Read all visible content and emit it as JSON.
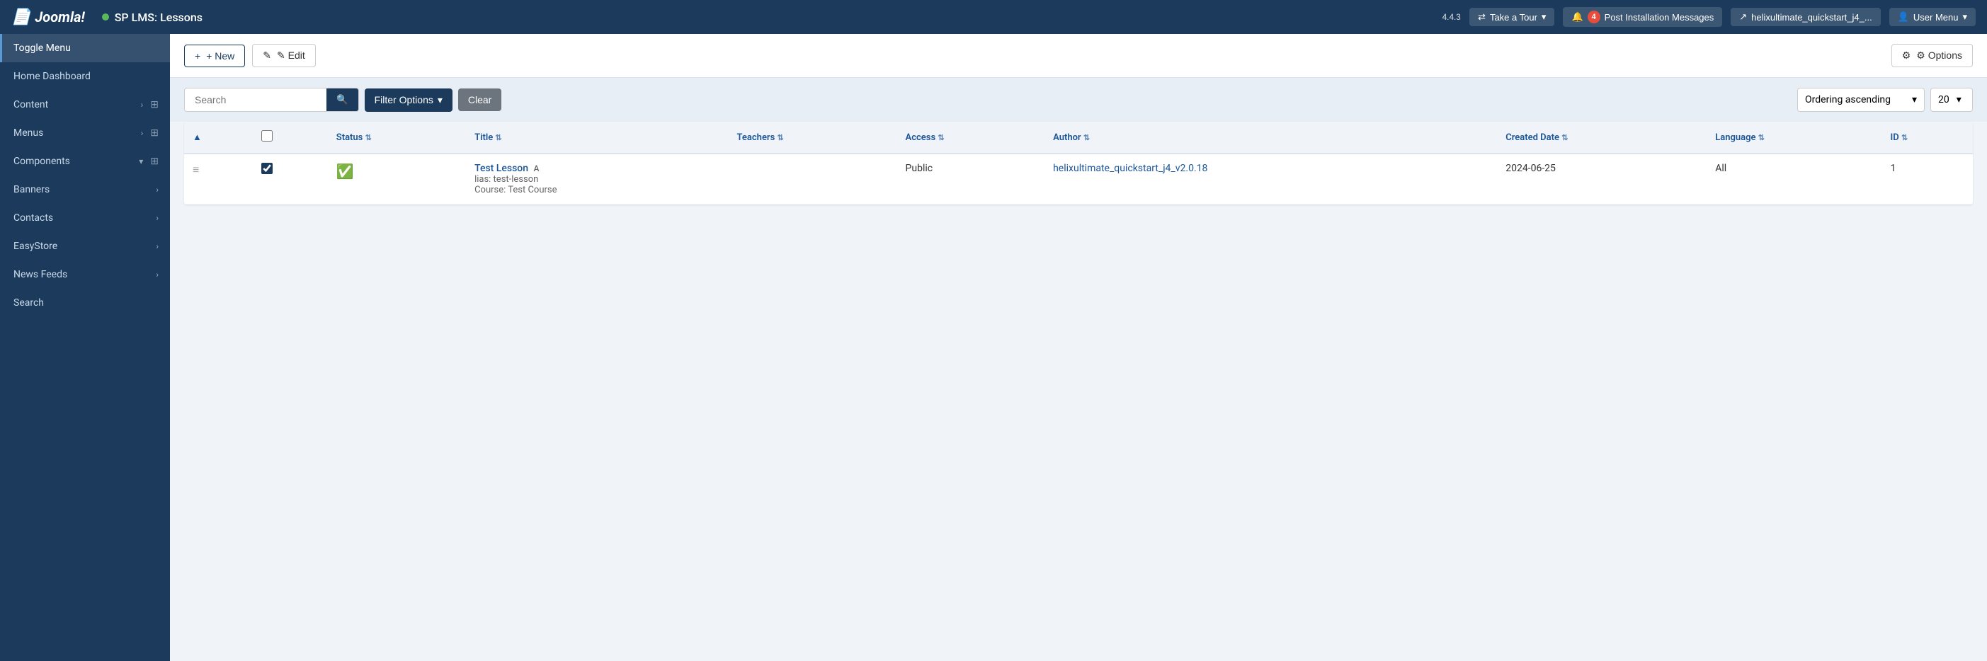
{
  "topNav": {
    "logo": "Joomla!",
    "pageTitle": "SP LMS: Lessons",
    "version": "4.4.3",
    "tourBtn": "Take a Tour",
    "notificationCount": "4",
    "postInstallMsg": "Post Installation Messages",
    "siteLink": "helixultimate_quickstart_j4_...",
    "userMenu": "User Menu"
  },
  "sidebar": {
    "toggleLabel": "Toggle Menu",
    "items": [
      {
        "id": "home-dashboard",
        "label": "Home Dashboard",
        "hasArrow": false,
        "hasGrid": false,
        "active": false
      },
      {
        "id": "content",
        "label": "Content",
        "hasArrow": true,
        "hasGrid": true,
        "active": false
      },
      {
        "id": "menus",
        "label": "Menus",
        "hasArrow": true,
        "hasGrid": true,
        "active": false
      },
      {
        "id": "components",
        "label": "Components",
        "hasArrow": true,
        "hasGrid": true,
        "active": false
      },
      {
        "id": "banners",
        "label": "Banners",
        "hasArrow": true,
        "hasGrid": false,
        "active": false
      },
      {
        "id": "contacts",
        "label": "Contacts",
        "hasArrow": true,
        "hasGrid": false,
        "active": false
      },
      {
        "id": "easystore",
        "label": "EasyStore",
        "hasArrow": true,
        "hasGrid": false,
        "active": false
      },
      {
        "id": "news-feeds",
        "label": "News Feeds",
        "hasArrow": true,
        "hasGrid": false,
        "active": false
      },
      {
        "id": "search",
        "label": "Search",
        "hasArrow": false,
        "hasGrid": false,
        "active": false
      }
    ]
  },
  "toolbar": {
    "newLabel": "+ New",
    "editLabel": "✎ Edit",
    "optionsLabel": "⚙ Options"
  },
  "filterBar": {
    "searchPlaceholder": "Search",
    "filterOptionsLabel": "Filter Options",
    "clearLabel": "Clear",
    "orderingLabel": "Ordering ascending",
    "perPage": "20"
  },
  "table": {
    "columns": [
      {
        "id": "sort",
        "label": "▲"
      },
      {
        "id": "checkbox",
        "label": ""
      },
      {
        "id": "status",
        "label": "Status"
      },
      {
        "id": "title",
        "label": "Title"
      },
      {
        "id": "teachers",
        "label": "Teachers"
      },
      {
        "id": "access",
        "label": "Access"
      },
      {
        "id": "author",
        "label": "Author"
      },
      {
        "id": "created-date",
        "label": "Created Date"
      },
      {
        "id": "language",
        "label": "Language"
      },
      {
        "id": "id",
        "label": "ID"
      }
    ],
    "rows": [
      {
        "dragHandle": "≡",
        "checked": true,
        "status": "published",
        "title": "Test Lesson",
        "titleSuffix": "A",
        "alias": "lias: test-lesson",
        "course": "Course: Test Course",
        "teachers": "",
        "access": "Public",
        "author": "helixultimate_quickstart_j4_v2.0.18",
        "createdDate": "2024-06-25",
        "language": "All",
        "id": "1"
      }
    ]
  }
}
